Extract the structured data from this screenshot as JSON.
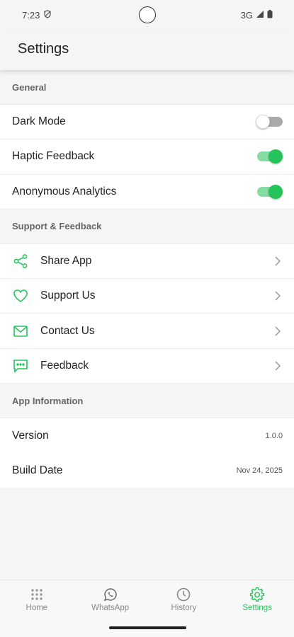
{
  "status_bar": {
    "time": "7:23",
    "network": "3G"
  },
  "app_bar": {
    "title": "Settings"
  },
  "sections": {
    "general": {
      "header": "General",
      "dark_mode": {
        "label": "Dark Mode",
        "enabled": false
      },
      "haptic_feedback": {
        "label": "Haptic Feedback",
        "enabled": true
      },
      "anonymous_analytics": {
        "label": "Anonymous Analytics",
        "enabled": true
      }
    },
    "support": {
      "header": "Support & Feedback",
      "share_app": {
        "label": "Share App",
        "icon": "share-icon"
      },
      "support_us": {
        "label": "Support Us",
        "icon": "heart-icon"
      },
      "contact_us": {
        "label": "Contact Us",
        "icon": "mail-icon"
      },
      "feedback": {
        "label": "Feedback",
        "icon": "chat-bubble-icon"
      }
    },
    "app_info": {
      "header": "App Information",
      "version": {
        "label": "Version",
        "value": "1.0.0"
      },
      "build_date": {
        "label": "Build Date",
        "value": "Nov 24, 2025"
      }
    }
  },
  "bottom_nav": {
    "items": [
      {
        "label": "Home",
        "icon": "grid-dots-icon",
        "active": false
      },
      {
        "label": "WhatsApp",
        "icon": "whatsapp-icon",
        "active": false
      },
      {
        "label": "History",
        "icon": "clock-icon",
        "active": false
      },
      {
        "label": "Settings",
        "icon": "gear-icon",
        "active": true
      }
    ]
  },
  "colors": {
    "accent": "#25c45a",
    "toggle_track_on": "#86dba3"
  }
}
